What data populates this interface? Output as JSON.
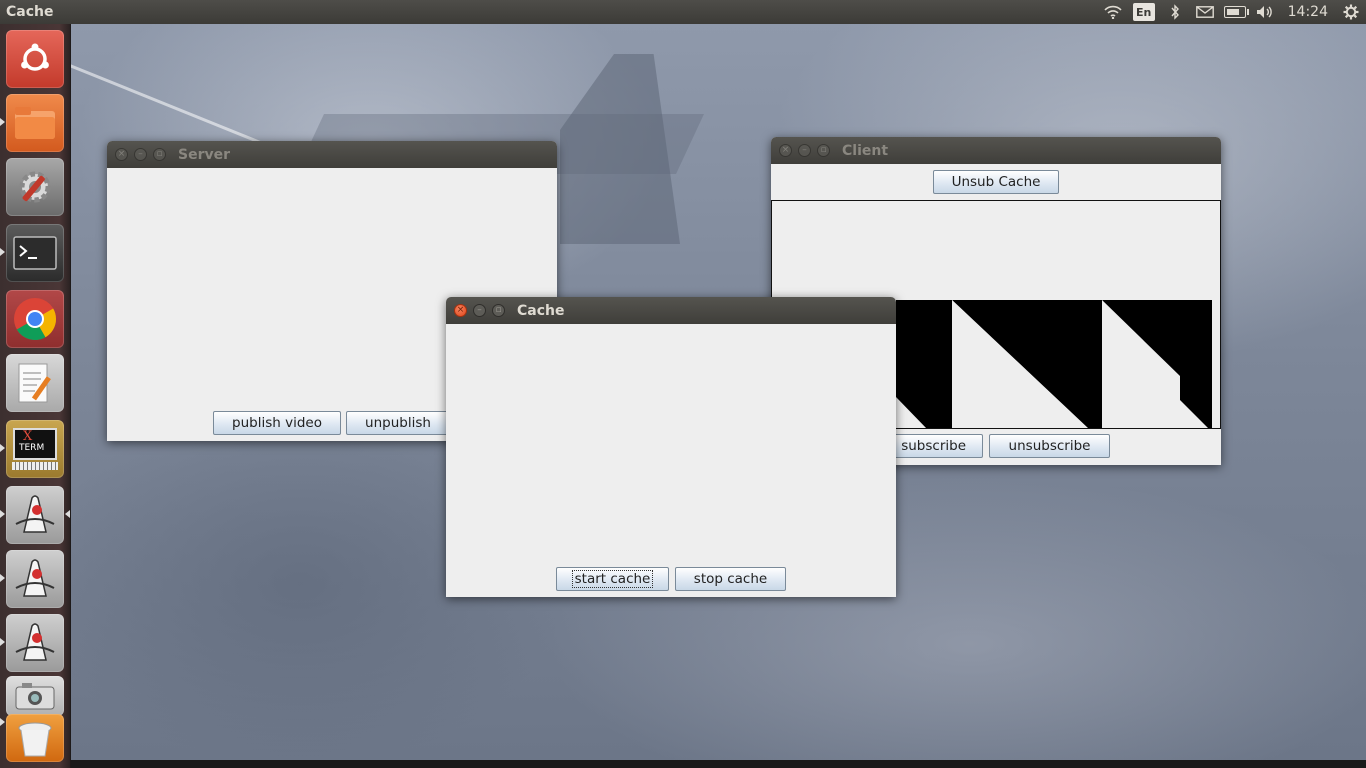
{
  "top_panel": {
    "active_app": "Cache",
    "keyboard_layout": "En",
    "clock": "14:24",
    "icons": [
      "wifi-icon",
      "keyboard-layout-icon",
      "bluetooth-icon",
      "mail-icon",
      "battery-icon",
      "volume-icon",
      "gear-icon"
    ]
  },
  "launcher": {
    "items": [
      {
        "name": "ubuntu-dash-icon"
      },
      {
        "name": "files-icon"
      },
      {
        "name": "system-settings-icon"
      },
      {
        "name": "terminal-icon"
      },
      {
        "name": "chrome-icon"
      },
      {
        "name": "text-editor-icon"
      },
      {
        "name": "xterm-icon",
        "label_top": "X",
        "label_bottom": "TERM"
      },
      {
        "name": "java-app-icon"
      },
      {
        "name": "java-app-icon"
      },
      {
        "name": "java-app-icon"
      },
      {
        "name": "camera-icon"
      },
      {
        "name": "trash-icon"
      }
    ]
  },
  "windows": {
    "server": {
      "title": "Server",
      "buttons": {
        "publish": "publish video",
        "unpublish": "unpublish"
      }
    },
    "client": {
      "title": "Client",
      "buttons": {
        "unsub_cache": "Unsub Cache",
        "subscribe_partial": "subscribe",
        "unsubscribe": "unsubscribe"
      }
    },
    "cache": {
      "title": "Cache",
      "buttons": {
        "start": "start cache",
        "stop": "stop cache"
      }
    }
  },
  "colors": {
    "panel": "#3c3b37",
    "launcher": "#4a3636",
    "window_bg": "#eeeeee",
    "close_active": "#e0461b",
    "button_gradient_end": "#c9d8e7"
  }
}
